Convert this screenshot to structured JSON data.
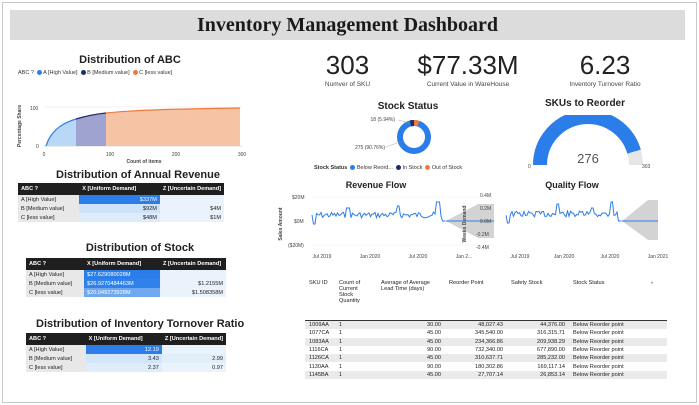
{
  "title": "Inventory Management Dashboard",
  "abc": {
    "title": "Distribution of ABC",
    "legend_label": "ABC ?",
    "legend": [
      {
        "label": "A [High Value]",
        "color": "#2b7de9"
      },
      {
        "label": "B [Medium value]",
        "color": "#1f2a6b"
      },
      {
        "label": "C [less value]",
        "color": "#f07a3e"
      }
    ],
    "ylabel": "Percentage Share",
    "xlabel": "Count of items",
    "yticks": [
      "100",
      "50",
      "0"
    ],
    "xticks": [
      "0",
      "100",
      "200",
      "300"
    ]
  },
  "annual_revenue": {
    "title": "Distribution of Annual Revenue",
    "headers": [
      "ABC ?",
      "X [Uniform Demand]",
      "Z [Uncertain Demand]"
    ],
    "rows": [
      {
        "label": "A [High Value]",
        "x": "$337M",
        "z": ""
      },
      {
        "label": "B [Medium value]",
        "x": "$92M",
        "z": "$4M"
      },
      {
        "label": "C [less value]",
        "x": "$48M",
        "z": "$1M"
      }
    ]
  },
  "stock": {
    "title": "Distribution of Stock",
    "headers": [
      "ABC ?",
      "X [Uniform Demand]",
      "Z [Uncertain Demand]"
    ],
    "rows": [
      {
        "label": "A [High Value]",
        "x": "$27.629080028M",
        "z": ""
      },
      {
        "label": "B [Medium value]",
        "x": "$26.9270484463M",
        "z": "$1.2155M"
      },
      {
        "label": "C [less value]",
        "x": "$20.049273928M",
        "z": "$1.508358M"
      }
    ]
  },
  "turnover": {
    "title": "Distribution of Inventory Tornover Ratio",
    "headers": [
      "ABC ?",
      "X [Uniform Demand]",
      "Z [Uncertain Demand]"
    ],
    "rows": [
      {
        "label": "A [High Value]",
        "x": "12.19",
        "z": ""
      },
      {
        "label": "B [Medium value]",
        "x": "3.43",
        "z": "2.99"
      },
      {
        "label": "C [less value]",
        "x": "2.37",
        "z": "0.97"
      }
    ]
  },
  "kpis": [
    {
      "value": "303",
      "label": "Numver of SKU"
    },
    {
      "value": "$77.33M",
      "label": "Current Value in WareHouse"
    },
    {
      "value": "6.23",
      "label": "Inventory Turnover Ratio"
    }
  ],
  "stock_status": {
    "title": "Stock Status",
    "label_small": "18 (5.94%)",
    "label_big": "275 (90.76%)",
    "legend_label": "Stock Status",
    "legend": [
      {
        "label": "Below Reord...",
        "color": "#2b7de9"
      },
      {
        "label": "In Stock",
        "color": "#1f2a6b"
      },
      {
        "label": "Out of Stock",
        "color": "#f07a3e"
      }
    ]
  },
  "reorder": {
    "title": "SKUs to Reorder",
    "value": "276",
    "min": "0",
    "max": "303",
    "fraction": 0.91
  },
  "revenue_flow": {
    "title": "Revenue Flow",
    "ylabel": "Sales Amount",
    "yticks": [
      "$20M",
      "$0M",
      "($20M)"
    ],
    "xticks": [
      "Jul 2019",
      "Jan 2020",
      "Jul 2020",
      "Jan 2..."
    ]
  },
  "quality_flow": {
    "title": "Quality Flow",
    "ylabel": "Weeks Demand",
    "yticks": [
      "0.4M",
      "0.2M",
      "0.0M",
      "-0.2M",
      "-0.4M"
    ],
    "xticks": [
      "Jul 2019",
      "Jan 2020",
      "Jul 2020",
      "Jan 2021"
    ]
  },
  "sku_table": {
    "headers": [
      "SKU ID",
      "Count of Current Stock Quantity",
      "Average of Average Lead Time (days)",
      "Reorder Point",
      "Safety Stock",
      "Stock Status"
    ],
    "rows": [
      [
        "1009AA",
        "1",
        "30.00",
        "48,027.43",
        "44,376.00",
        "Below Reorder point"
      ],
      [
        "1077CA",
        "1",
        "45.00",
        "345,540.00",
        "316,315.71",
        "Below Reorder point"
      ],
      [
        "1083AA",
        "1",
        "45.00",
        "234,366.86",
        "209,938.29",
        "Below Reorder point"
      ],
      [
        "1116CA",
        "1",
        "90.00",
        "732,340.00",
        "677,890.00",
        "Below Reorder point"
      ],
      [
        "1126CA",
        "1",
        "45.00",
        "310,637.71",
        "285,232.00",
        "Below Reorder point"
      ],
      [
        "1130AA",
        "1",
        "90.00",
        "180,302.86",
        "169,117.14",
        "Below Reorder point"
      ],
      [
        "1145BA",
        "1",
        "45.00",
        "27,707.14",
        "26,853.14",
        "Below Reorder point"
      ]
    ]
  }
}
